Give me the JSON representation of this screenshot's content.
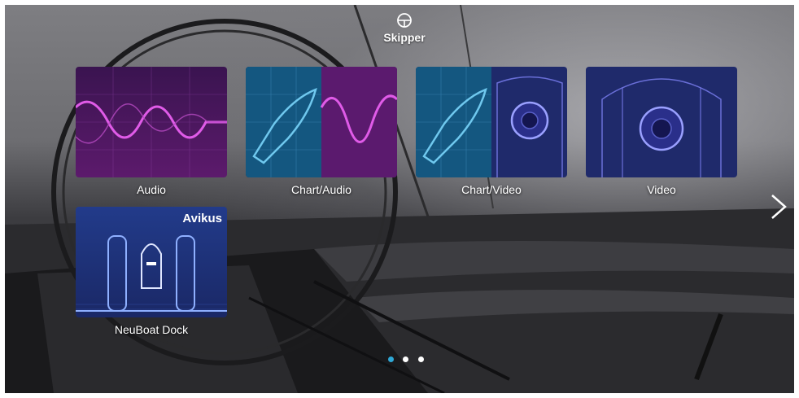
{
  "header": {
    "title": "Skipper",
    "icon": "helm-icon"
  },
  "tiles": [
    {
      "label": "Audio",
      "icon": "sine-wave-icon"
    },
    {
      "label": "Chart/Audio",
      "icon": "boat-wave-icon"
    },
    {
      "label": "Chart/Video",
      "icon": "boat-camera-icon"
    },
    {
      "label": "Video",
      "icon": "camera-icon"
    },
    {
      "label": "NeuBoat Dock",
      "badge": "Avikus",
      "icon": "dock-icon"
    }
  ],
  "pager": {
    "pages": 3,
    "active_page": 1
  },
  "navigation": {
    "next_icon": "chevron-right-icon"
  },
  "colors": {
    "accent": "#2fa8d6",
    "purple": "#5b1a6e",
    "navy": "#1f2a6b",
    "chart_blue": "#155a86"
  }
}
